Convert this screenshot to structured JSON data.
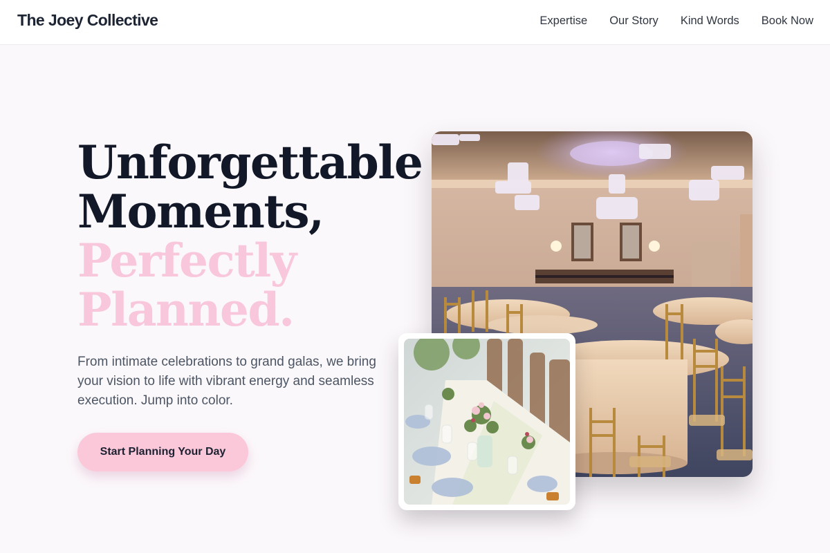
{
  "header": {
    "brand": "The Joey Collective",
    "nav": [
      {
        "label": "Expertise"
      },
      {
        "label": "Our Story"
      },
      {
        "label": "Kind Words"
      },
      {
        "label": "Book Now"
      }
    ]
  },
  "hero": {
    "title_lines": [
      "Unforgettable",
      "Moments,"
    ],
    "accent_lines": [
      "Perfectly",
      "Planned."
    ],
    "subtitle": "From intimate celebrations to grand galas, we bring your vision to life with vibrant energy and seamless execution. Jump into color.",
    "cta_label": "Start Planning Your Day"
  },
  "colors": {
    "accent_pink": "#f9c7db",
    "heading_dark": "#121828",
    "background": "#fbf8fb"
  }
}
